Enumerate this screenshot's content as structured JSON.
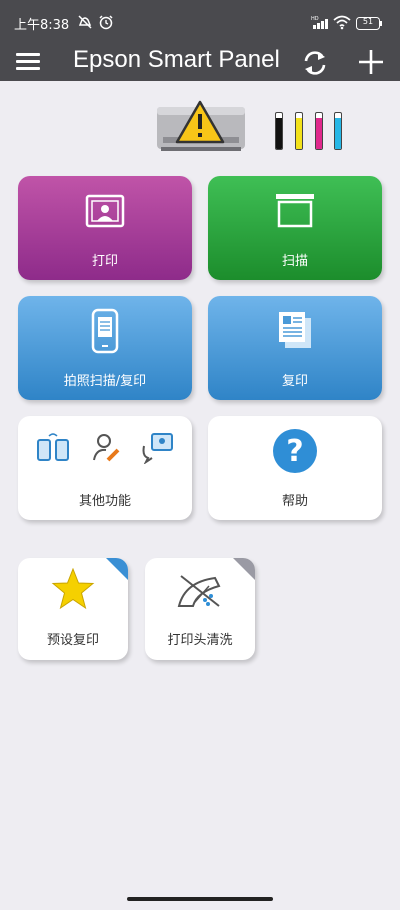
{
  "status_bar": {
    "time": "上午8:38",
    "battery": "51",
    "icons": [
      "mute-icon",
      "alarm-icon",
      "signal-icon",
      "wifi-icon",
      "battery-icon"
    ]
  },
  "app_bar": {
    "title": "Epson Smart Panel",
    "icons": [
      "menu-icon",
      "refresh-icon",
      "add-icon"
    ]
  },
  "printer": {
    "status_icon": "warning-icon",
    "ink_colors": [
      "#111111",
      "#f3e21a",
      "#e0288c",
      "#27b7e6"
    ],
    "ink_levels": [
      0.85,
      0.85,
      0.85,
      0.85
    ]
  },
  "tiles": {
    "print": {
      "label": "打印",
      "icon": "photo-icon",
      "color": "#a53f9a"
    },
    "scan": {
      "label": "扫描",
      "icon": "scanner-icon",
      "color": "#27a23a"
    },
    "photo_scan_copy": {
      "label": "拍照扫描/复印",
      "icon": "phone-document-icon",
      "color": "#4a9ad8"
    },
    "copy": {
      "label": "复印",
      "icon": "copy-icon",
      "color": "#4a9ad8"
    },
    "other": {
      "label": "其他功能",
      "icons": [
        "devices-icon",
        "user-edit-icon",
        "chat-image-icon"
      ]
    },
    "help": {
      "label": "帮助",
      "icon": "question-icon",
      "color": "#2f8ed6"
    },
    "preset_copy": {
      "label": "预设复印",
      "icon": "star-icon",
      "color": "#f5d000"
    },
    "head_cleaning": {
      "label": "打印头清洗",
      "icon": "nozzle-icon"
    }
  }
}
